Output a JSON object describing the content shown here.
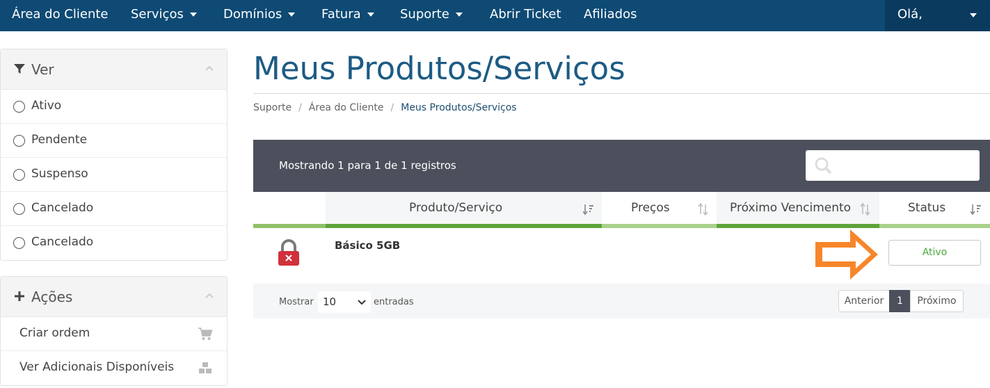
{
  "nav": {
    "items": [
      {
        "label": "Área do Cliente",
        "caret": false
      },
      {
        "label": "Serviços",
        "caret": true
      },
      {
        "label": "Domínios",
        "caret": true
      },
      {
        "label": "Fatura",
        "caret": true
      },
      {
        "label": "Suporte",
        "caret": true
      },
      {
        "label": "Abrir Ticket",
        "caret": false
      },
      {
        "label": "Afiliados",
        "caret": false
      }
    ],
    "user_label": "Olá,"
  },
  "sidebar": {
    "filter": {
      "title": "Ver",
      "icon": "filter-icon",
      "options": [
        "Ativo",
        "Pendente",
        "Suspenso",
        "Cancelado",
        "Cancelado"
      ]
    },
    "actions": {
      "title": "Ações",
      "icon": "plus-icon",
      "items": [
        {
          "label": "Criar ordem",
          "icon": "cart-icon"
        },
        {
          "label": "Ver Adicionais Disponíveis",
          "icon": "cubes-icon"
        }
      ]
    }
  },
  "main": {
    "title": "Meus Produtos/Serviços",
    "breadcrumb": [
      "Suporte",
      "Área do Cliente",
      "Meus Produtos/Serviços"
    ],
    "table": {
      "info": "Mostrando 1 para 1 de 1 registros",
      "columns": [
        "Produto/Serviço",
        "Preços",
        "Próximo Vencimento",
        "Status"
      ],
      "rows": [
        {
          "product": "Básico 5GB",
          "status": "Ativo",
          "icon": "lock-icon"
        }
      ],
      "footer": {
        "show_label": "Mostrar",
        "page_size": "10",
        "entries_label": "entradas",
        "prev": "Anterior",
        "page": "1",
        "next": "Próximo"
      }
    }
  },
  "colors": {
    "navbar": "#0e4a74",
    "title": "#1d5b84",
    "table_header_bar": "#4c505c",
    "sort_highlight": "#8fc266",
    "status_active": "#4caa3c",
    "arrow": "#f7862a",
    "lock": "#d0313b"
  }
}
